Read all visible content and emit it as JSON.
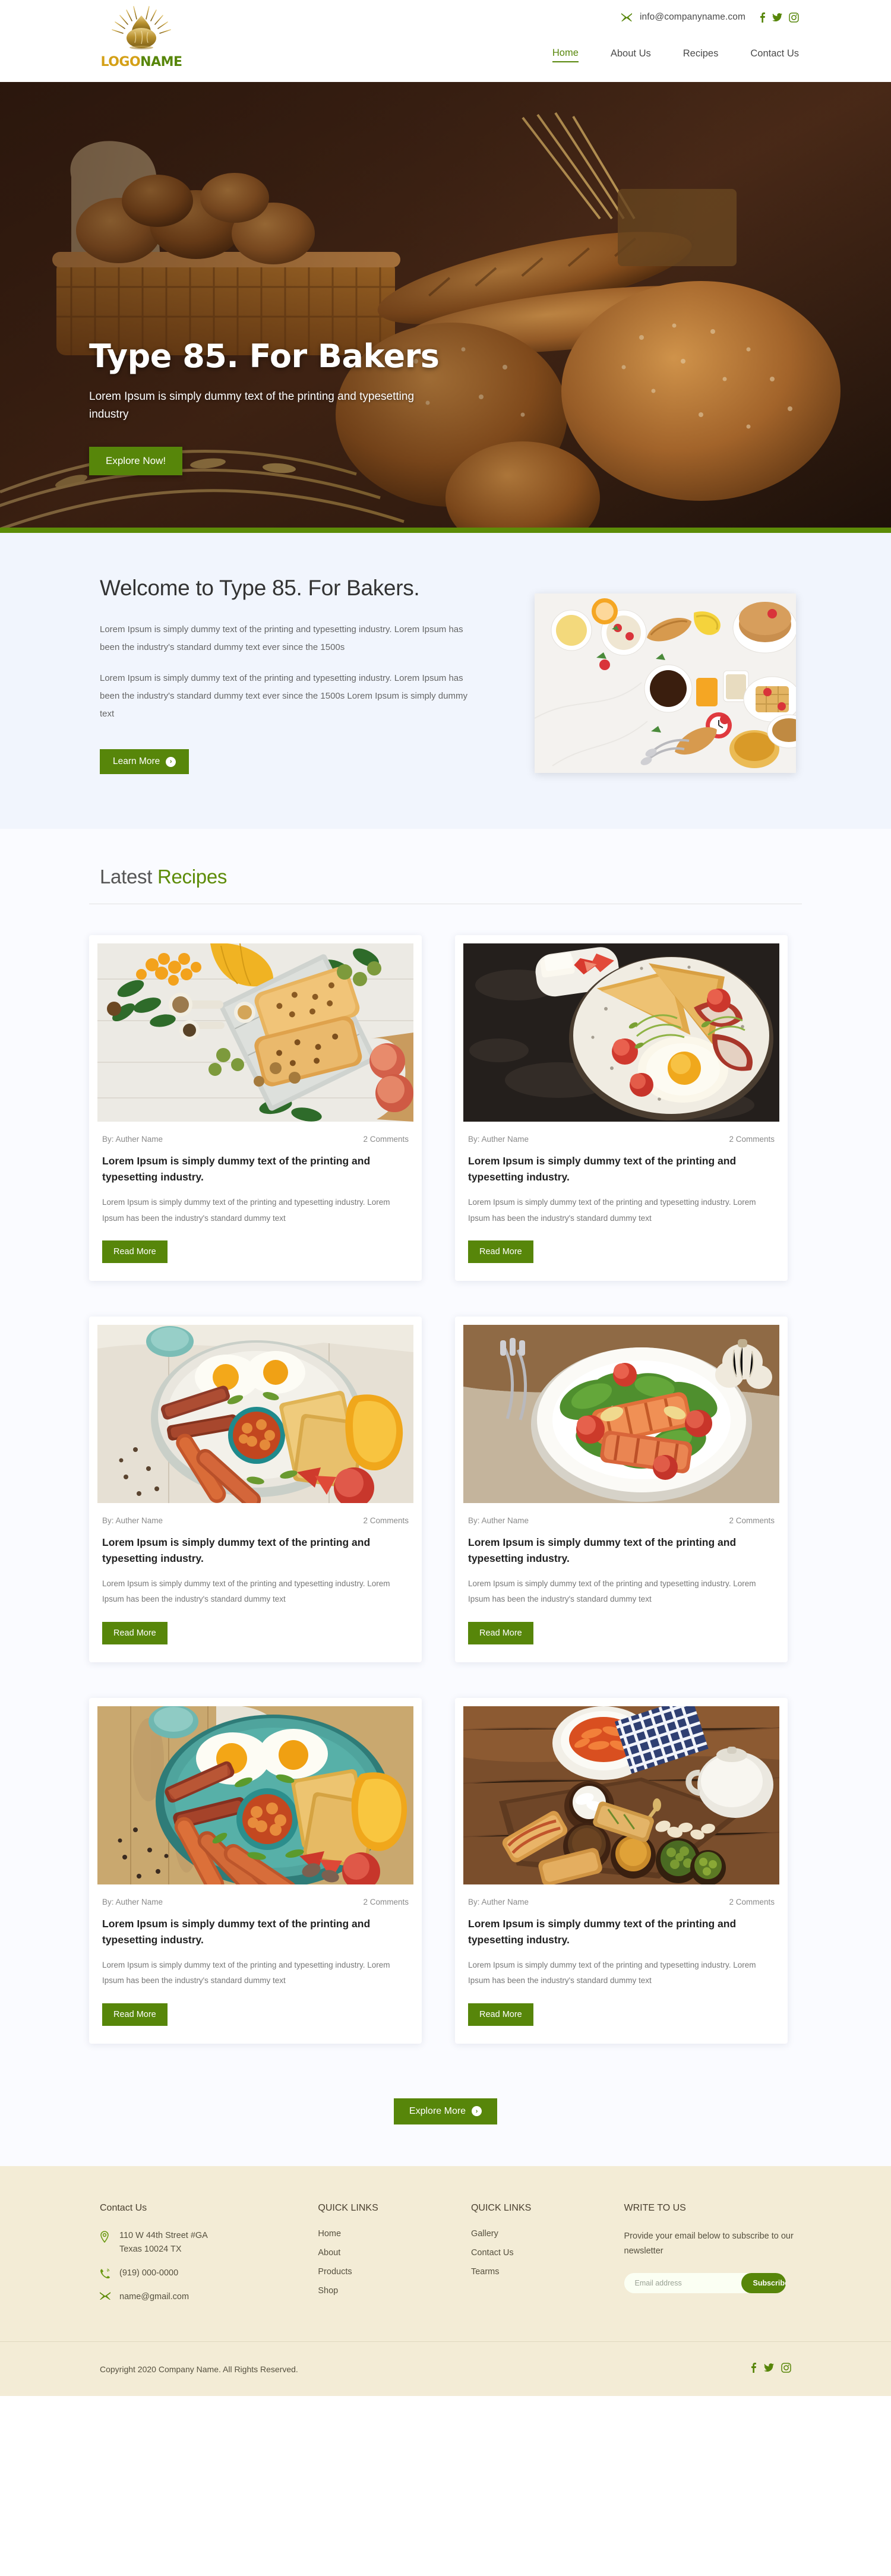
{
  "header": {
    "logo": {
      "primary": "LOGO",
      "secondary": "NAME",
      "icon": "bread-sunburst-logo-icon"
    },
    "email": "info@companyname.com",
    "email_icon": "envelope-icon",
    "social": [
      {
        "name": "facebook-icon",
        "glyph": "f"
      },
      {
        "name": "twitter-icon",
        "glyph": "t"
      },
      {
        "name": "instagram-icon",
        "glyph": "i"
      }
    ],
    "nav": [
      {
        "label": "Home",
        "active": true
      },
      {
        "label": "About Us",
        "active": false
      },
      {
        "label": "Recipes",
        "active": false
      },
      {
        "label": "Contact Us",
        "active": false
      }
    ]
  },
  "hero": {
    "title": "Type 85. For Bakers",
    "subtitle": "Lorem Ipsum is simply dummy text of the printing and typesetting industry",
    "cta": "Explore Now!"
  },
  "welcome": {
    "title": "Welcome to Type 85. For Bakers.",
    "paragraph_1": "Lorem Ipsum is simply dummy text of the printing and typesetting industry. Lorem Ipsum has been the industry's standard dummy text ever since the 1500s",
    "paragraph_2": "Lorem Ipsum is simply dummy text of the printing and typesetting industry. Lorem Ipsum has been the industry's standard dummy text ever since the 1500s Lorem Ipsum is simply dummy text",
    "cta": "Learn More",
    "image_alt": "breakfast-spread-photo"
  },
  "recipes": {
    "title_plain": "Latest ",
    "title_highlight": "Recipes",
    "explore_more": "Explore More",
    "cards": [
      {
        "author": "By: Auther Name",
        "comments": "2 Comments",
        "title": "Lorem Ipsum is simply dummy text of the printing and typesetting industry.",
        "text": "Lorem Ipsum is simply dummy text of the printing and typesetting industry. Lorem Ipsum has been the industry's standard dummy text",
        "cta": "Read More",
        "image_alt": "pastry-on-board-photo"
      },
      {
        "author": "By: Auther Name",
        "comments": "2 Comments",
        "title": "Lorem Ipsum is simply dummy text of the printing and typesetting industry.",
        "text": "Lorem Ipsum is simply dummy text of the printing and typesetting industry. Lorem Ipsum has been the industry's standard dummy text",
        "cta": "Read More",
        "image_alt": "toast-bacon-egg-dark-photo"
      },
      {
        "author": "By: Auther Name",
        "comments": "2 Comments",
        "title": "Lorem Ipsum is simply dummy text of the printing and typesetting industry.",
        "text": "Lorem Ipsum is simply dummy text of the printing and typesetting industry. Lorem Ipsum has been the industry's standard dummy text",
        "cta": "Read More",
        "image_alt": "sausage-egg-tomato-photo"
      },
      {
        "author": "By: Auther Name",
        "comments": "2 Comments",
        "title": "Lorem Ipsum is simply dummy text of the printing and typesetting industry.",
        "text": "Lorem Ipsum is simply dummy text of the printing and typesetting industry. Lorem Ipsum has been the industry's standard dummy text",
        "cta": "Read More",
        "image_alt": "grilled-salmon-salad-photo"
      },
      {
        "author": "By: Auther Name",
        "comments": "2 Comments",
        "title": "Lorem Ipsum is simply dummy text of the printing and typesetting industry.",
        "text": "Lorem Ipsum is simply dummy text of the printing and typesetting industry. Lorem Ipsum has been the industry's standard dummy text",
        "cta": "Read More",
        "image_alt": "full-english-breakfast-photo"
      },
      {
        "author": "By: Auther Name",
        "comments": "2 Comments",
        "title": "Lorem Ipsum is simply dummy text of the printing and typesetting industry.",
        "text": "Lorem Ipsum is simply dummy text of the printing and typesetting industry. Lorem Ipsum has been the industry's standard dummy text",
        "cta": "Read More",
        "image_alt": "mezze-platter-wood-photo"
      }
    ]
  },
  "footer": {
    "contact": {
      "title": "Contact Us",
      "address_line_1": "110 W 44th Street #GA",
      "address_line_2": "Texas 10024 TX",
      "phone": "(919) 000-0000",
      "email": "name@gmail.com",
      "location_icon": "map-pin-icon",
      "phone_icon": "phone-icon",
      "email_icon": "envelope-icon"
    },
    "quick_links_1": {
      "title": "QUICK LINKS",
      "links": [
        "Home",
        "About",
        "Products",
        "Shop"
      ]
    },
    "quick_links_2": {
      "title": "QUICK LINKS",
      "links": [
        "Gallery",
        "Contact Us",
        "Tearms"
      ]
    },
    "write_to_us": {
      "title": "WRITE TO US",
      "description": "Provide your email below to subscribe to our newsletter",
      "input_placeholder": "Email address",
      "input_value": "",
      "button": "Subscribe"
    },
    "copyright": "Copyright 2020 Company Name.  All Rights Reserved.",
    "social": [
      {
        "name": "facebook-icon"
      },
      {
        "name": "twitter-icon"
      },
      {
        "name": "instagram-icon"
      }
    ]
  },
  "colors": {
    "green": "#57860a",
    "green_bar": "#5d8c08",
    "gold": "#d4a017",
    "footer_bg": "#f3ecd6",
    "welcome_bg": "#f1f5fd"
  }
}
